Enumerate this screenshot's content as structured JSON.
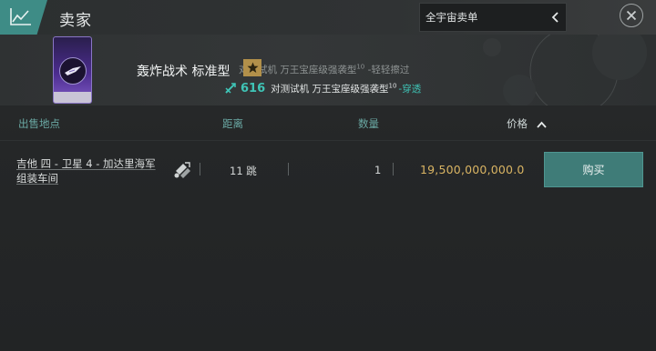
{
  "header": {
    "title": "卖家",
    "scope_label": "全宇宙卖单",
    "brand_icon": "chart-line-icon",
    "close_icon": "close-icon"
  },
  "item": {
    "name": "轰炸战术 标准型",
    "effect_line": "对测试机 万王宝座级强袭型",
    "effect_line_sup": "10",
    "effect_line_suffix": "-轻轻擦过",
    "damage_value": "616",
    "damage_target": "对测试机 万王宝座级强袭型",
    "damage_target_sup": "10",
    "damage_tag": "-穿透"
  },
  "table": {
    "columns": {
      "location": "出售地点",
      "distance": "距离",
      "quantity": "数量",
      "price": "价格"
    },
    "sort": {
      "column": "price",
      "direction": "ascending"
    },
    "rows": [
      {
        "location_line1": "吉他 四 - 卫星 4 - 加达里海军",
        "location_line2": "组装车间",
        "jumps": "11 跳",
        "quantity": "1",
        "price": "19,500,000,000.0",
        "buy_label": "购买"
      }
    ]
  },
  "colors": {
    "accent": "#3e8c86",
    "button": "#3f7c78",
    "price": "#d9b463",
    "damage": "#3fc4b6",
    "column_header": "#6aa8a3"
  }
}
